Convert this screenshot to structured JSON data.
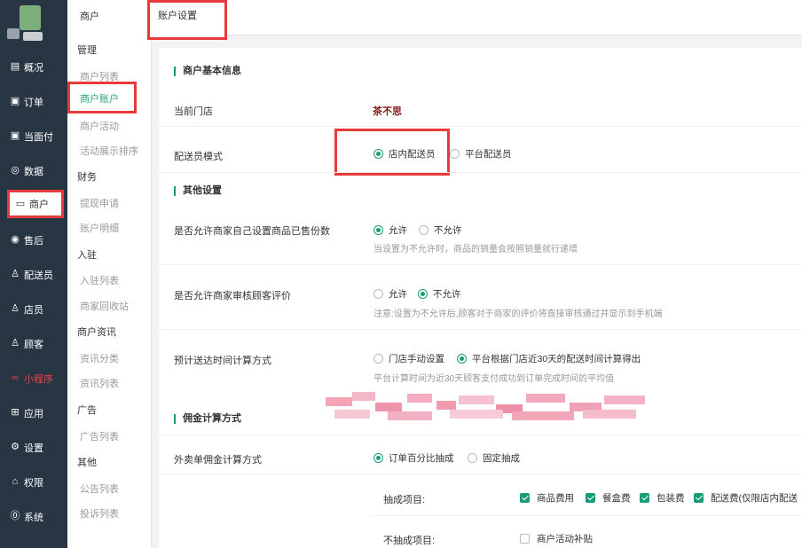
{
  "sidebar": {
    "items": [
      {
        "label": "概况",
        "icon": "overview-icon"
      },
      {
        "label": "订单",
        "icon": "order-icon"
      },
      {
        "label": "当面付",
        "icon": "face-pay-icon"
      },
      {
        "label": "数据",
        "icon": "data-icon"
      },
      {
        "label": "商户",
        "icon": "merchant-icon"
      },
      {
        "label": "售后",
        "icon": "after-sale-icon"
      },
      {
        "label": "配送员",
        "icon": "courier-icon"
      },
      {
        "label": "店员",
        "icon": "clerk-icon"
      },
      {
        "label": "顾客",
        "icon": "customer-icon"
      },
      {
        "label": "小程序",
        "icon": "miniprogram-icon"
      },
      {
        "label": "应用",
        "icon": "apps-icon"
      },
      {
        "label": "设置",
        "icon": "settings-icon"
      },
      {
        "label": "权限",
        "icon": "permission-icon"
      },
      {
        "label": "系统",
        "icon": "system-icon"
      }
    ]
  },
  "subnav": {
    "title": "商户",
    "groups": {
      "manage": "管理",
      "finance": "财务",
      "join": "入驻",
      "news": "商户资讯",
      "ad": "广告",
      "other": "其他"
    },
    "items": {
      "merchant_list": "商户列表",
      "merchant_account": "商户账户",
      "merchant_activity": "商户活动",
      "activity_sort": "活动展示排序",
      "withdraw": "提现申请",
      "account_detail": "账户明细",
      "join_list": "入驻列表",
      "recycle": "商家回收站",
      "news_category": "资讯分类",
      "news_list": "资讯列表",
      "ad_list": "广告列表",
      "notice_list": "公告列表",
      "complaint_list": "投诉列表"
    }
  },
  "tab": {
    "label": "账户设置"
  },
  "basic": {
    "title": "商户基本信息",
    "store_label": "当前门店",
    "store_name": "茶不思",
    "courier_label": "配送员模式",
    "courier_opt1": "店内配送员",
    "courier_opt2": "平台配送员"
  },
  "other": {
    "title": "其他设置",
    "sold_label": "是否允许商家自己设置商品已售份数",
    "sold_allow": "允许",
    "sold_deny": "不允许",
    "sold_hint": "当设置为不允许时，商品的销量会按照销量就行递增",
    "review_label": "是否允许商家审核顾客评价",
    "review_allow": "允许",
    "review_deny": "不允许",
    "review_hint": "注意:设置为不允许后,顾客对于商家的评价将直接审核通过并显示到手机端",
    "eta_label": "预计送达时间计算方式",
    "eta_opt1": "门店手动设置",
    "eta_opt2": "平台根据门店近30天的配送时间计算得出",
    "eta_hint": "平台计算时间为近30天顾客支付成功到订单完成时间的平均值"
  },
  "commission": {
    "title": "佣金计算方式",
    "takeout_label": "外卖单佣金计算方式",
    "opt_percent": "订单百分比抽成",
    "opt_fixed": "固定抽成",
    "include_label": "抽成项目:",
    "include_items": [
      "商品费用",
      "餐盒费",
      "包装费",
      "配送费(仅限店内配送"
    ],
    "exclude_label": "不抽成项目:",
    "exclude_items": [
      "商户活动补贴"
    ]
  },
  "colors": {
    "accent": "#1c9b78",
    "sidebar": "#283644",
    "highlight": "#e83a3a",
    "store": "#8b1a1a"
  }
}
